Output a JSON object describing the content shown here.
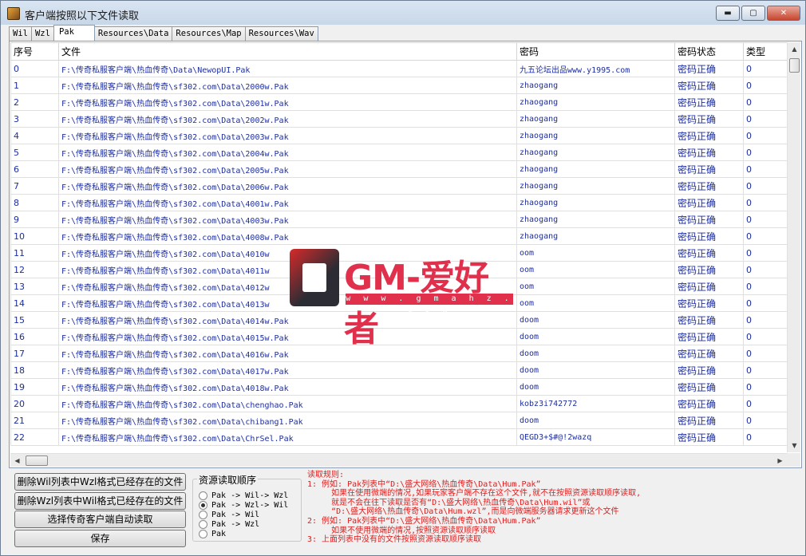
{
  "window": {
    "title": "客户端按照以下文件读取",
    "minimize": "▬",
    "maximize": "▢",
    "close": "✕"
  },
  "tabs": [
    "Wil",
    "Wzl",
    "Pak",
    "Resources\\Data",
    "Resources\\Map",
    "Resources\\Wav"
  ],
  "active_tab": "Pak",
  "table": {
    "headers": [
      "序号",
      "文件",
      "密码",
      "密码状态",
      "类型"
    ],
    "rows": [
      [
        "0",
        "F:\\传奇私服客户端\\热血传奇\\Data\\NewopUI.Pak",
        "九五论坛出品www.y1995.com",
        "密码正确",
        "0"
      ],
      [
        "1",
        "F:\\传奇私服客户端\\热血传奇\\sf302.com\\Data\\2000w.Pak",
        "zhaogang",
        "密码正确",
        "0"
      ],
      [
        "2",
        "F:\\传奇私服客户端\\热血传奇\\sf302.com\\Data\\2001w.Pak",
        "zhaogang",
        "密码正确",
        "0"
      ],
      [
        "3",
        "F:\\传奇私服客户端\\热血传奇\\sf302.com\\Data\\2002w.Pak",
        "zhaogang",
        "密码正确",
        "0"
      ],
      [
        "4",
        "F:\\传奇私服客户端\\热血传奇\\sf302.com\\Data\\2003w.Pak",
        "zhaogang",
        "密码正确",
        "0"
      ],
      [
        "5",
        "F:\\传奇私服客户端\\热血传奇\\sf302.com\\Data\\2004w.Pak",
        "zhaogang",
        "密码正确",
        "0"
      ],
      [
        "6",
        "F:\\传奇私服客户端\\热血传奇\\sf302.com\\Data\\2005w.Pak",
        "zhaogang",
        "密码正确",
        "0"
      ],
      [
        "7",
        "F:\\传奇私服客户端\\热血传奇\\sf302.com\\Data\\2006w.Pak",
        "zhaogang",
        "密码正确",
        "0"
      ],
      [
        "8",
        "F:\\传奇私服客户端\\热血传奇\\sf302.com\\Data\\4001w.Pak",
        "zhaogang",
        "密码正确",
        "0"
      ],
      [
        "9",
        "F:\\传奇私服客户端\\热血传奇\\sf302.com\\Data\\4003w.Pak",
        "zhaogang",
        "密码正确",
        "0"
      ],
      [
        "10",
        "F:\\传奇私服客户端\\热血传奇\\sf302.com\\Data\\4008w.Pak",
        "zhaogang",
        "密码正确",
        "0"
      ],
      [
        "11",
        "F:\\传奇私服客户端\\热血传奇\\sf302.com\\Data\\4010w",
        "oom",
        "密码正确",
        "0"
      ],
      [
        "12",
        "F:\\传奇私服客户端\\热血传奇\\sf302.com\\Data\\4011w",
        "oom",
        "密码正确",
        "0"
      ],
      [
        "13",
        "F:\\传奇私服客户端\\热血传奇\\sf302.com\\Data\\4012w",
        "oom",
        "密码正确",
        "0"
      ],
      [
        "14",
        "F:\\传奇私服客户端\\热血传奇\\sf302.com\\Data\\4013w",
        "oom",
        "密码正确",
        "0"
      ],
      [
        "15",
        "F:\\传奇私服客户端\\热血传奇\\sf302.com\\Data\\4014w.Pak",
        "doom",
        "密码正确",
        "0"
      ],
      [
        "16",
        "F:\\传奇私服客户端\\热血传奇\\sf302.com\\Data\\4015w.Pak",
        "doom",
        "密码正确",
        "0"
      ],
      [
        "17",
        "F:\\传奇私服客户端\\热血传奇\\sf302.com\\Data\\4016w.Pak",
        "doom",
        "密码正确",
        "0"
      ],
      [
        "18",
        "F:\\传奇私服客户端\\热血传奇\\sf302.com\\Data\\4017w.Pak",
        "doom",
        "密码正确",
        "0"
      ],
      [
        "19",
        "F:\\传奇私服客户端\\热血传奇\\sf302.com\\Data\\4018w.Pak",
        "doom",
        "密码正确",
        "0"
      ],
      [
        "20",
        "F:\\传奇私服客户端\\热血传奇\\sf302.com\\Data\\chenghao.Pak",
        "kobz3i742772",
        "密码正确",
        "0"
      ],
      [
        "21",
        "F:\\传奇私服客户端\\热血传奇\\sf302.com\\Data\\chibang1.Pak",
        "doom",
        "密码正确",
        "0"
      ],
      [
        "22",
        "F:\\传奇私服客户端\\热血传奇\\sf302.com\\Data\\ChrSel.Pak",
        "QEGD3+$#@!2wazq",
        "密码正确",
        "0"
      ]
    ]
  },
  "watermark": {
    "brand": "GM-爱好者",
    "url": "w w w . g m a h z . c o m"
  },
  "buttons": {
    "delete_wil": "删除Wil列表中Wzl格式已经存在的文件",
    "delete_wzl": "删除Wzl列表中Wil格式已经存在的文件",
    "auto_read": "选择传奇客户端自动读取",
    "save": "保存"
  },
  "read_order": {
    "title": "资源读取顺序",
    "options": [
      "Pak -> Wil-> Wzl",
      "Pak -> Wzl-> Wil",
      "Pak -> Wil",
      "Pak -> Wzl",
      "Pak"
    ],
    "selected_index": 1
  },
  "rules": [
    "读取规则:",
    "1: 例如: Pak列表中“D:\\盛大网络\\热血传奇\\Data\\Hum.Pak”",
    "     如果在使用微端的情况,如果玩家客户端不存在这个文件,就不在按照资源读取顺序读取,",
    "     就是不会在往下读取是否有“D:\\盛大网络\\热血传奇\\Data\\Hum.wil”或",
    "     “D:\\盛大网络\\热血传奇\\Data\\Hum.wzl”,而是向微端服务器请求更新这个文件",
    "2: 例如: Pak列表中“D:\\盛大网络\\热血传奇\\Data\\Hum.Pak”",
    "     如果不使用微端的情况,按照资源读取顺序读取",
    "3: 上面列表中没有的文件按照资源读取顺序读取"
  ]
}
